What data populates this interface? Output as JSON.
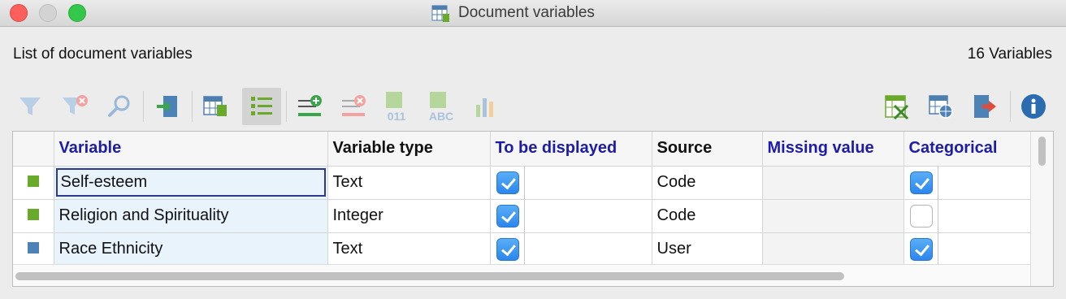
{
  "window": {
    "title": "Document variables"
  },
  "header": {
    "list_label": "List of document variables",
    "count_label": "16 Variables"
  },
  "toolbar": {
    "left": [
      "filter-icon",
      "clear-filter-icon",
      "search-icon",
      "import-icon",
      "data-editor-icon",
      "list-view-icon",
      "new-variable-icon",
      "delete-variable-icon",
      "numeric-variable-icon",
      "text-variable-icon",
      "statistics-icon"
    ],
    "right": [
      "excel-export-icon",
      "html-export-icon",
      "export-icon",
      "info-icon"
    ],
    "active": "list-view-icon"
  },
  "table": {
    "columns": [
      "Variable",
      "Variable type",
      "To be displayed",
      "Source",
      "Missing value",
      "Categorical"
    ],
    "rows": [
      {
        "color": "#6aaa2a",
        "variable": "Self-esteem",
        "type": "Text",
        "displayed": true,
        "source": "Code",
        "missing": "",
        "categorical": true,
        "editing": true
      },
      {
        "color": "#6aaa2a",
        "variable": "Religion and Spirituality",
        "type": "Integer",
        "displayed": true,
        "source": "Code",
        "missing": "",
        "categorical": false,
        "editing": false
      },
      {
        "color": "#4c82b5",
        "variable": "Race Ethnicity",
        "type": "Text",
        "displayed": true,
        "source": "User",
        "missing": "",
        "categorical": true,
        "editing": false
      }
    ]
  },
  "colors": {
    "header_blue": "#1c1ca8",
    "check_blue": "#2b86ee",
    "selection_bg": "#e8f3fc"
  }
}
